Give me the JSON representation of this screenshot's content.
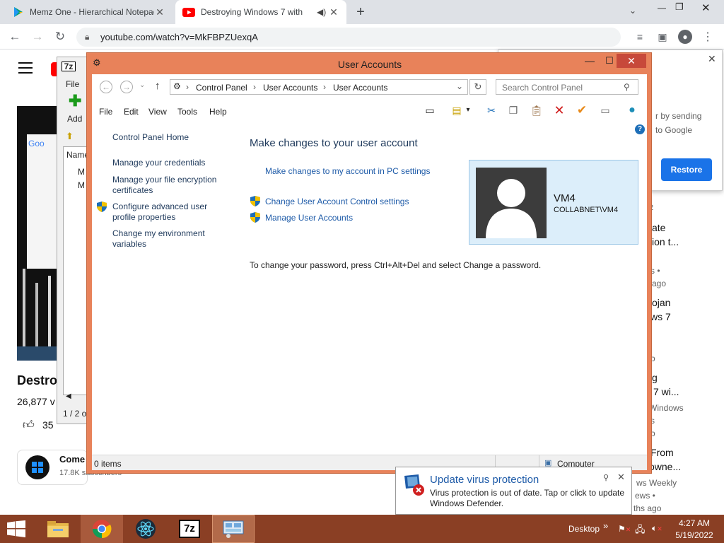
{
  "browser": {
    "tabs": [
      {
        "title": "Memz One - Hierarchical Notepad",
        "close": "✕"
      },
      {
        "title": "Destroying Windows 7 with",
        "close": "✕"
      }
    ],
    "new_tab": "+",
    "url": "youtube.com/watch?v=MkFBPZUexqA"
  },
  "youtube": {
    "title_partial": "Destro",
    "views_partial": "26,877 v",
    "likes_partial": "35",
    "channel_partial": "Come",
    "subscribers_partial": "17.8K subscribers",
    "right_texts": [
      "r by sending",
      "to Google",
      "2",
      "ate",
      "ion t...",
      "s •",
      "ago",
      "ojan",
      "ws 7",
      "o",
      "g",
      "7 wi...",
      "Windows",
      "s",
      "o",
      "From",
      "owne...",
      "ws Weekly",
      "ews •",
      "ths ago"
    ],
    "restore_label": "Restore"
  },
  "sevenzip": {
    "menu_file": "File",
    "add_label": "Add",
    "col_name": "Name",
    "row1": "M",
    "row2": "M",
    "status": "1 / 2 o"
  },
  "window": {
    "title": "User Accounts",
    "breadcrumb": [
      "Control Panel",
      "User Accounts",
      "User Accounts"
    ],
    "search_placeholder": "Search Control Panel",
    "menu": [
      "File",
      "Edit",
      "View",
      "Tools",
      "Help"
    ],
    "sidebar": {
      "home": "Control Panel Home",
      "items": [
        "Manage your credentials",
        "Manage your file encryption certificates",
        "Configure advanced user profile properties",
        "Change my environment variables"
      ]
    },
    "main": {
      "heading": "Make changes to your user account",
      "pc_settings_link": "Make changes to my account in PC settings",
      "uac_link": "Change User Account Control settings",
      "manage_link": "Manage User Accounts",
      "password_note": "To change your password, press Ctrl+Alt+Del and select Change a password."
    },
    "account": {
      "name": "VM4",
      "domain": "COLLABNET\\VM4"
    },
    "status": {
      "items": "0 items",
      "location": "Computer"
    }
  },
  "notification": {
    "title": "Update virus protection",
    "body": "Virus protection is out of date. Tap or click to update Windows Defender."
  },
  "taskbar": {
    "desktop_label": "Desktop",
    "time": "4:27 AM",
    "date": "5/19/2022",
    "chevron": "»"
  },
  "colors": {
    "window_frame": "#e8825a",
    "taskbar": "#8a3f24",
    "link": "#1e5ba8",
    "heading": "#1e395b",
    "restore_button": "#1a73e8"
  }
}
